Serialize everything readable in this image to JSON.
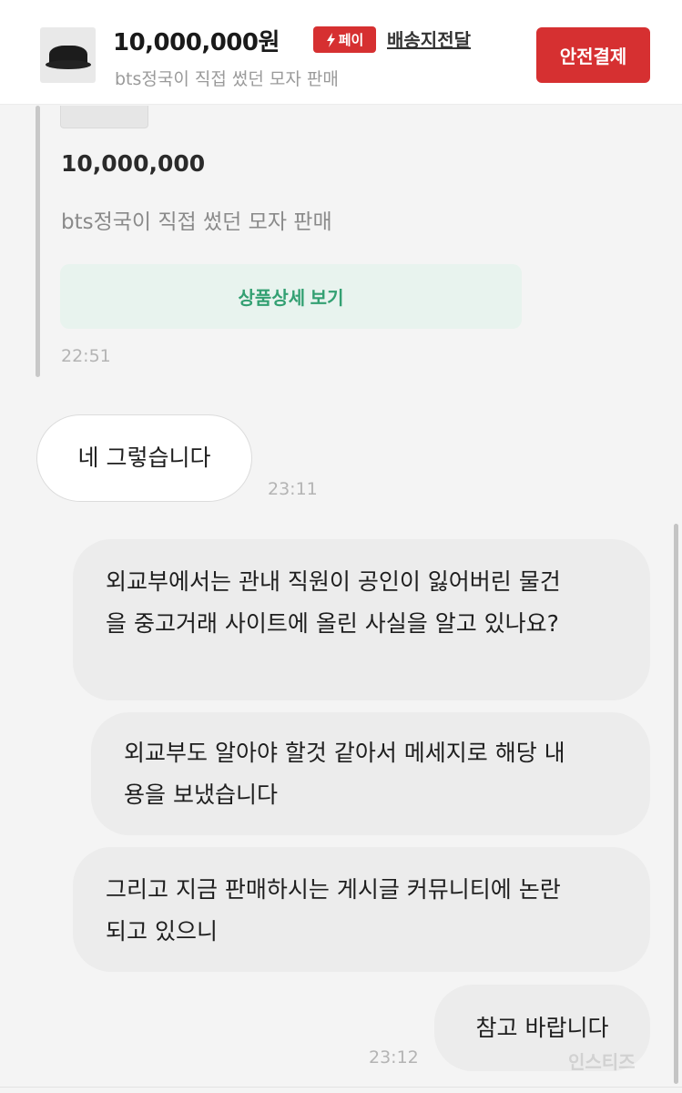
{
  "header": {
    "price": "10,000,000원",
    "pay_badge": "페이",
    "delivery_label": "배송지전달",
    "product_title": "bts정국이 직접 썼던 모자 판매",
    "safe_pay_button": "안전결제"
  },
  "shared_card": {
    "price": "10,000,000",
    "title": "bts정국이 직접 썼던 모자 판매",
    "detail_button": "상품상세 보기",
    "time": "22:51"
  },
  "messages": [
    {
      "side": "received",
      "lines": [
        "네 그렇습니다"
      ],
      "time": "23:11"
    },
    {
      "side": "sent",
      "lines": [
        "외교부에서는 관내 직원이 공인이 잃어버린 물건",
        "을 중고거래 사이트에 올린 사실을 알고 있나요?"
      ]
    },
    {
      "side": "sent",
      "lines": [
        "외교부도 알아야 할것 같아서 메세지로 해당 내",
        "용을 보냈습니다"
      ]
    },
    {
      "side": "sent",
      "lines": [
        "그리고 지금 판매하시는 게시글 커뮤니티에 논란",
        "되고 있으니"
      ]
    },
    {
      "side": "sent",
      "lines": [
        "참고 바랍니다"
      ],
      "time": "23:12"
    }
  ],
  "watermark": "인스티즈",
  "colors": {
    "accent_red": "#d63031",
    "detail_green": "#33a072",
    "detail_bg": "#e8f3ee",
    "sent_bubble": "#ececec",
    "received_bubble": "#ffffff",
    "background": "#f4f4f4"
  },
  "icons": {
    "pay_badge_icon": "lightning-bolt-icon",
    "product_thumbnail": "black-bucket-hat"
  }
}
